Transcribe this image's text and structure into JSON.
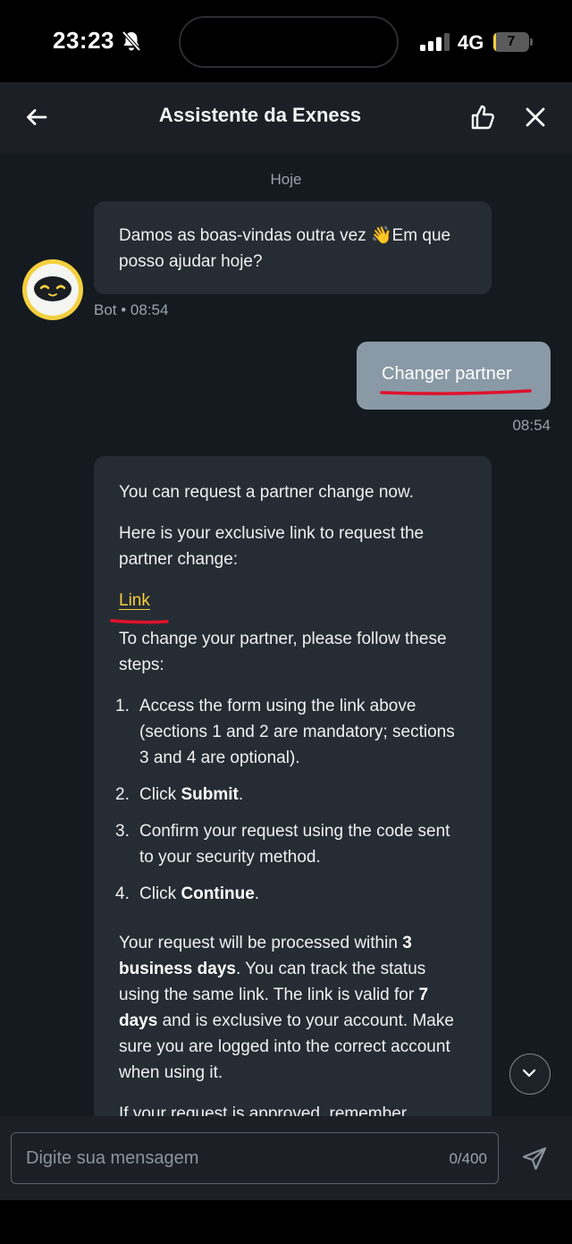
{
  "status_bar": {
    "time": "23:23",
    "network": "4G",
    "battery": "7",
    "battery_percent": 7
  },
  "header": {
    "title": "Assistente da Exness"
  },
  "chat": {
    "date_separator": "Hoje",
    "messages": [
      {
        "sender": "bot",
        "text": "Damos as boas-vindas outra vez 👋Em que posso ajudar hoje?",
        "meta": "Bot • 08:54"
      },
      {
        "sender": "user",
        "text": "Changer partner",
        "meta": "08:54"
      },
      {
        "sender": "bot",
        "p1": "You can request a partner change now.",
        "p2": "Here is your exclusive link to request the partner change:",
        "link": "Link",
        "p3": "To change your partner, please follow these steps:",
        "steps": [
          {
            "num": "1.",
            "text": "Access the form using the link above (sections 1 and 2 are mandatory; sections 3 and 4 are optional)."
          },
          {
            "num": "2.",
            "pre": "Click ",
            "bold": "Submit",
            "post": "."
          },
          {
            "num": "3.",
            "text": "Confirm your request using the code sent to your security method."
          },
          {
            "num": "4.",
            "pre": "Click ",
            "bold": "Continue",
            "post": "."
          }
        ],
        "p4_a": "Your request will be processed within ",
        "p4_b": "3 business days",
        "p4_c": ". You can track the status using the same link. The link is valid for ",
        "p4_d": "7 days",
        "p4_e": " and is exclusive to your account. Make sure you are logged into the correct account when using it.",
        "p5": "If your request is approved, remember"
      }
    ]
  },
  "input": {
    "placeholder": "Digite sua mensagem",
    "counter": "0/400"
  },
  "colors": {
    "accent_yellow": "#f4d03f",
    "annotation_red": "#e0112b",
    "user_bubble": "#8a99a6",
    "bot_bubble": "#262c33"
  }
}
